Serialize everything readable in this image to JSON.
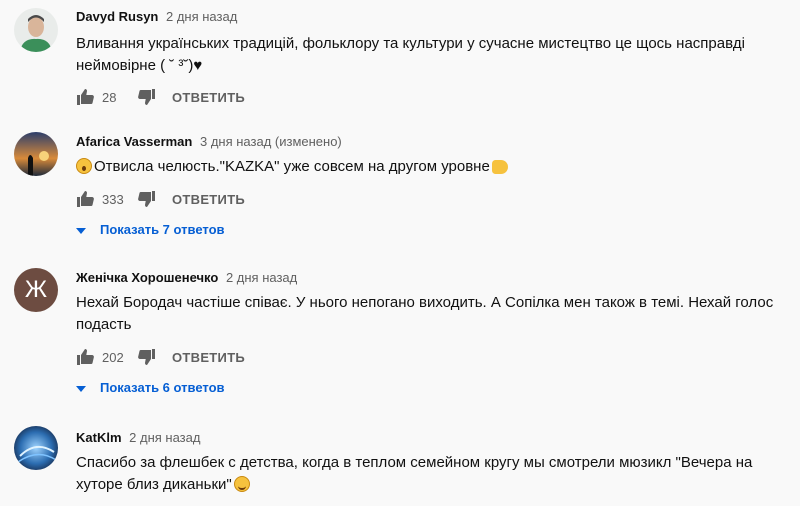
{
  "comments": [
    {
      "author": "Davyd Rusyn",
      "meta": "2 дня назад",
      "text": "Вливання українських традицій, фольклору та культури у сучасне мистецтво це щось насправді неймовірне ( ˘ ³˘)♥",
      "likes": "28",
      "reply_label": "ОТВЕТИТЬ",
      "avatar_icon": "person-photo-icon"
    },
    {
      "author": "Afarica Vasserman",
      "meta": "3 дня назад (изменено)",
      "text_prefix_emoji": "astonished-face-icon",
      "text": "Отвисла челюсть.\"KAZKA\" уже совсем на другом уровне",
      "text_suffix_emoji": "flexed-biceps-icon",
      "likes": "333",
      "reply_label": "ОТВЕТИТЬ",
      "show_replies": "Показать 7 ответов",
      "avatar_icon": "sunset-photo-icon"
    },
    {
      "author": "Женічка Хорошенечко",
      "meta": "2 дня назад",
      "avatar_letter": "Ж",
      "avatar_color": "#6d4c41",
      "text": "Нехай Бородач частіше співає. У нього непогано виходить. А Сопілка мен також в темі. Нехай голос подасть",
      "likes": "202",
      "reply_label": "ОТВЕТИТЬ",
      "show_replies": "Показать 6 ответов"
    },
    {
      "author": "KatKlm",
      "meta": "2 дня назад",
      "text": "Спасибо за флешбек с детства, когда в теплом семейном кругу мы смотрели мюзикл \"Вечера на хуторе близ диканьки\"",
      "text_suffix_emoji": "smiling-face-icon",
      "avatar_icon": "abstract-photo-icon"
    }
  ],
  "colors": {
    "background": "#f9f9f9",
    "link": "#065fd4",
    "meta": "#606060"
  }
}
